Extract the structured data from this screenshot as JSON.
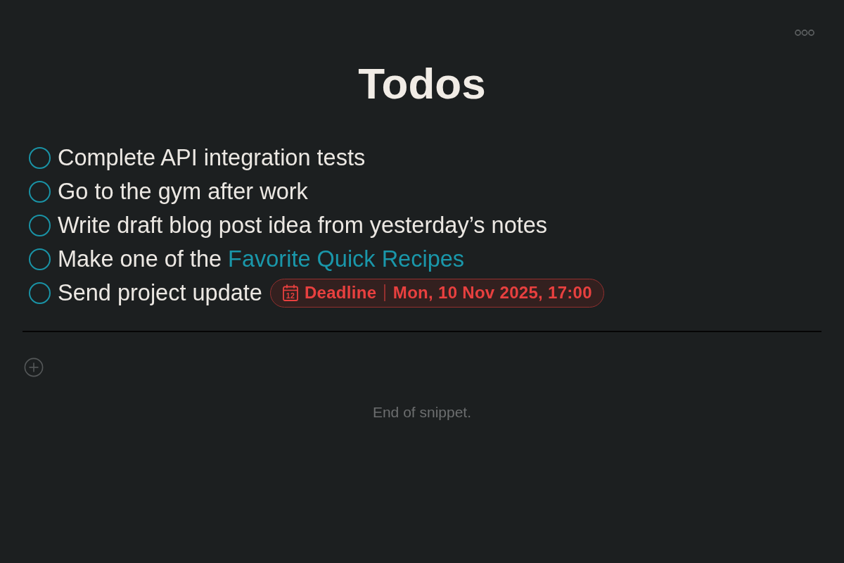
{
  "title": "Todos",
  "todos": [
    {
      "text": "Complete API integration tests",
      "checked": false
    },
    {
      "text": "Go to the gym after work",
      "checked": false
    },
    {
      "text": "Write draft blog post idea from yesterday’s notes",
      "checked": false
    },
    {
      "text": "Make one of the",
      "link": "Favorite Quick Recipes",
      "checked": false
    },
    {
      "text": "Send project update",
      "checked": false,
      "deadline": {
        "label": "Deadline",
        "icon_day": "12",
        "date": "Mon, 10 Nov 2025, 17:00"
      }
    }
  ],
  "footer": "End of snippet."
}
